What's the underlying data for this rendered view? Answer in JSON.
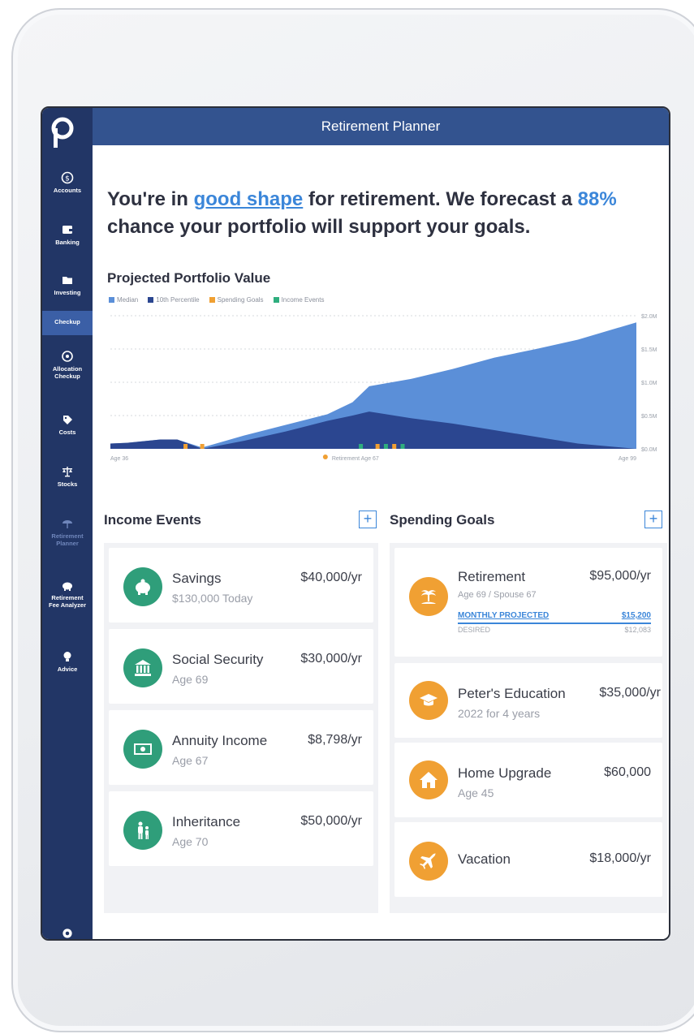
{
  "app": {
    "title": "Retirement Planner"
  },
  "sidebar": {
    "items": [
      {
        "label": "Accounts",
        "icon": "dollar-circle-icon"
      },
      {
        "label": "Banking",
        "icon": "wallet-icon"
      },
      {
        "label": "Investing",
        "icon": "folder-icon"
      },
      {
        "label": "Checkup",
        "icon": ""
      },
      {
        "label": "Allocation\nCheckup",
        "icon": "target-icon"
      },
      {
        "label": "Costs",
        "icon": "tag-icon"
      },
      {
        "label": "Stocks",
        "icon": "scale-icon"
      },
      {
        "label": "Retirement\nPlanner",
        "icon": "umbrella-chair-icon"
      },
      {
        "label": "Retirement\nFee Analyzer",
        "icon": "piggy-icon"
      },
      {
        "label": "Advice",
        "icon": "lightbulb-icon"
      }
    ]
  },
  "headline": {
    "prefix": "You're in ",
    "link": "good shape",
    "middle": " for retirement. We forecast a ",
    "pct": "88%",
    "suffix": " chance your portfolio will support your goals."
  },
  "chart_data": {
    "type": "area",
    "title": "Projected Portfolio Value",
    "legend": [
      "Median",
      "10th Percentile",
      "Spending Goals",
      "Income Events"
    ],
    "x_start_label": "Age 36",
    "x_mid_label": "Retirement Age 67",
    "x_end_label": "Age 99",
    "y_ticks": [
      "$2.0M",
      "$1.5M",
      "$1.0M",
      "$0.5M",
      "$0.0M"
    ],
    "ylim": [
      0,
      2.0
    ],
    "x": [
      36,
      38,
      42,
      44,
      47,
      52,
      57,
      62,
      65,
      67,
      72,
      77,
      82,
      87,
      92,
      99
    ],
    "series": [
      {
        "name": "Median",
        "values": [
          0.08,
          0.09,
          0.14,
          0.14,
          0.02,
          0.2,
          0.36,
          0.52,
          0.7,
          0.94,
          1.05,
          1.2,
          1.37,
          1.5,
          1.64,
          1.9
        ]
      },
      {
        "name": "10th Percentile",
        "values": [
          0.08,
          0.09,
          0.14,
          0.14,
          0.0,
          0.12,
          0.26,
          0.42,
          0.5,
          0.56,
          0.46,
          0.38,
          0.28,
          0.18,
          0.08,
          0.0
        ]
      }
    ],
    "spending_goal_ages": [
      45,
      47,
      68,
      70
    ],
    "income_event_ages": [
      66,
      69,
      71
    ],
    "colors": {
      "median": "#5b8fd8",
      "p10": "#2b4690",
      "spending": "#f0a033",
      "income": "#2fae7e"
    }
  },
  "income": {
    "title": "Income Events",
    "add": "+",
    "items": [
      {
        "name": "Savings",
        "sub": "$130,000 Today",
        "amount": "$40,000/yr",
        "icon": "piggy-bank-icon"
      },
      {
        "name": "Social Security",
        "sub": "Age 69",
        "amount": "$30,000/yr",
        "icon": "bank-building-icon"
      },
      {
        "name": "Annuity Income",
        "sub": "Age 67",
        "amount": "$8,798/yr",
        "icon": "money-bill-icon"
      },
      {
        "name": "Inheritance",
        "sub": "Age 70",
        "amount": "$50,000/yr",
        "icon": "elderly-person-icon"
      }
    ]
  },
  "spending": {
    "title": "Spending Goals",
    "add": "+",
    "retirement": {
      "name": "Retirement",
      "sub": "Age 69 / Spouse 67",
      "amount": "$95,000/yr",
      "monthly_label": "MONTHLY PROJECTED",
      "monthly_value": "$15,200",
      "desired_label": "DESIRED",
      "desired_value": "$12,083",
      "icon": "palm-island-icon"
    },
    "items": [
      {
        "name": "Peter's Education",
        "sub": "2022 for 4 years",
        "amount": "$35,000/yr",
        "icon": "graduation-cap-icon"
      },
      {
        "name": "Home Upgrade",
        "sub": "Age 45",
        "amount": "$60,000",
        "icon": "house-icon"
      },
      {
        "name": "Vacation",
        "sub": "",
        "amount": "$18,000/yr",
        "icon": "airplane-icon"
      }
    ]
  }
}
